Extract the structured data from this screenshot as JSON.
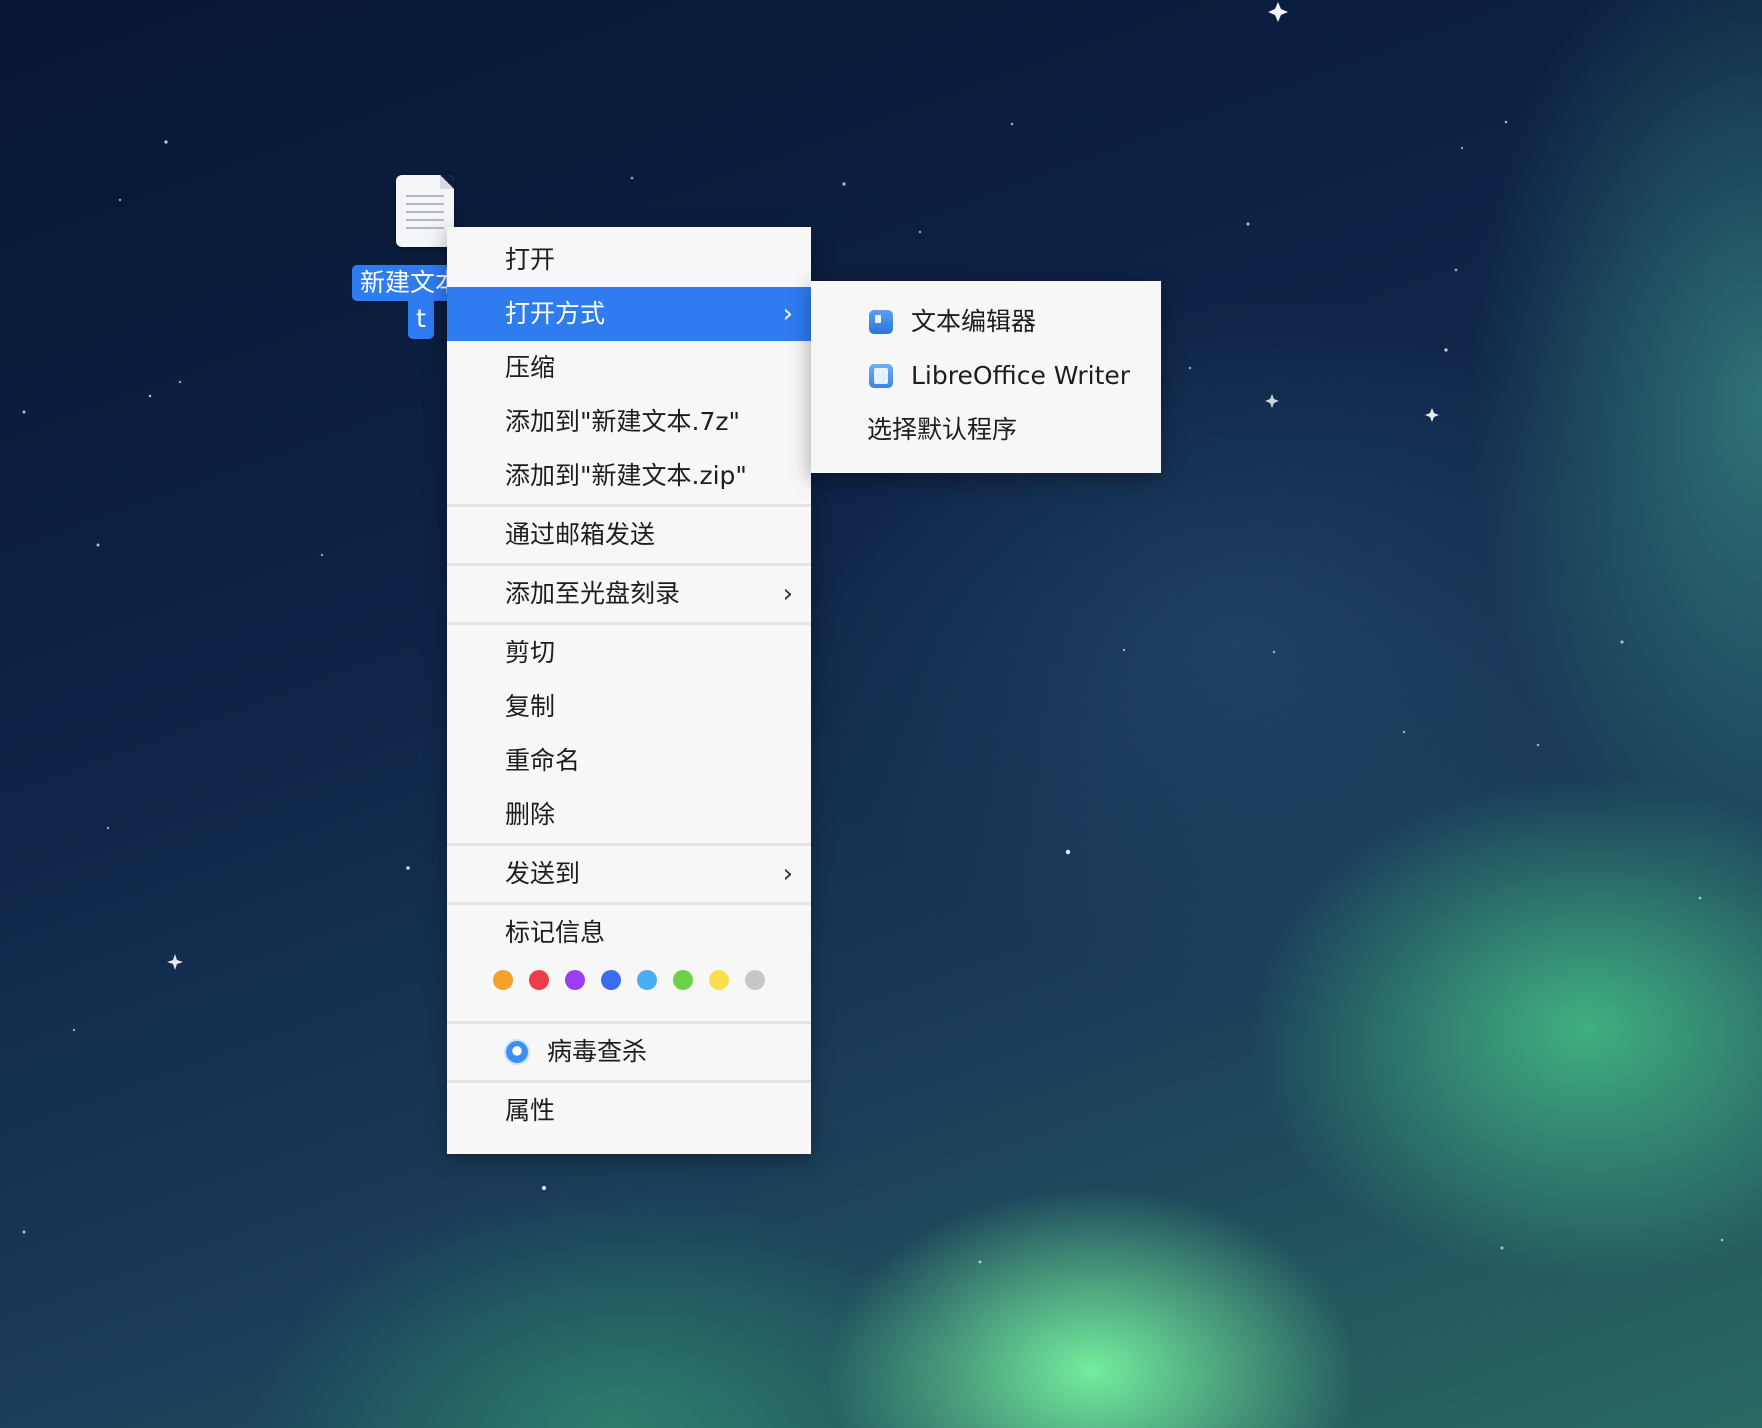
{
  "desktop": {
    "file": {
      "label_line1": "新建文本",
      "label_line2": "t"
    }
  },
  "context_menu": {
    "items": {
      "open": "打开",
      "open_with": "打开方式",
      "compress": "压缩",
      "add_7z": "添加到\"新建文本.7z\"",
      "add_zip": "添加到\"新建文本.zip\"",
      "send_mail": "通过邮箱发送",
      "add_burn": "添加至光盘刻录",
      "cut": "剪切",
      "copy": "复制",
      "rename": "重命名",
      "delete": "删除",
      "send_to": "发送到",
      "tag_info": "标记信息",
      "virus_scan": "病毒查杀",
      "properties": "属性"
    },
    "chevron": "›",
    "tag_colors": [
      "#f4a02b",
      "#ee3c4a",
      "#9b3df0",
      "#3b6cf0",
      "#4aaef5",
      "#6fd14a",
      "#f7e04a",
      "#c7c7c7"
    ],
    "active_item": "open_with",
    "accent_color": "#2f7bf0"
  },
  "open_with_submenu": {
    "items": {
      "text_editor": "文本编辑器",
      "libreoffice_writer": "LibreOffice Writer",
      "choose_default": "选择默认程序"
    }
  }
}
